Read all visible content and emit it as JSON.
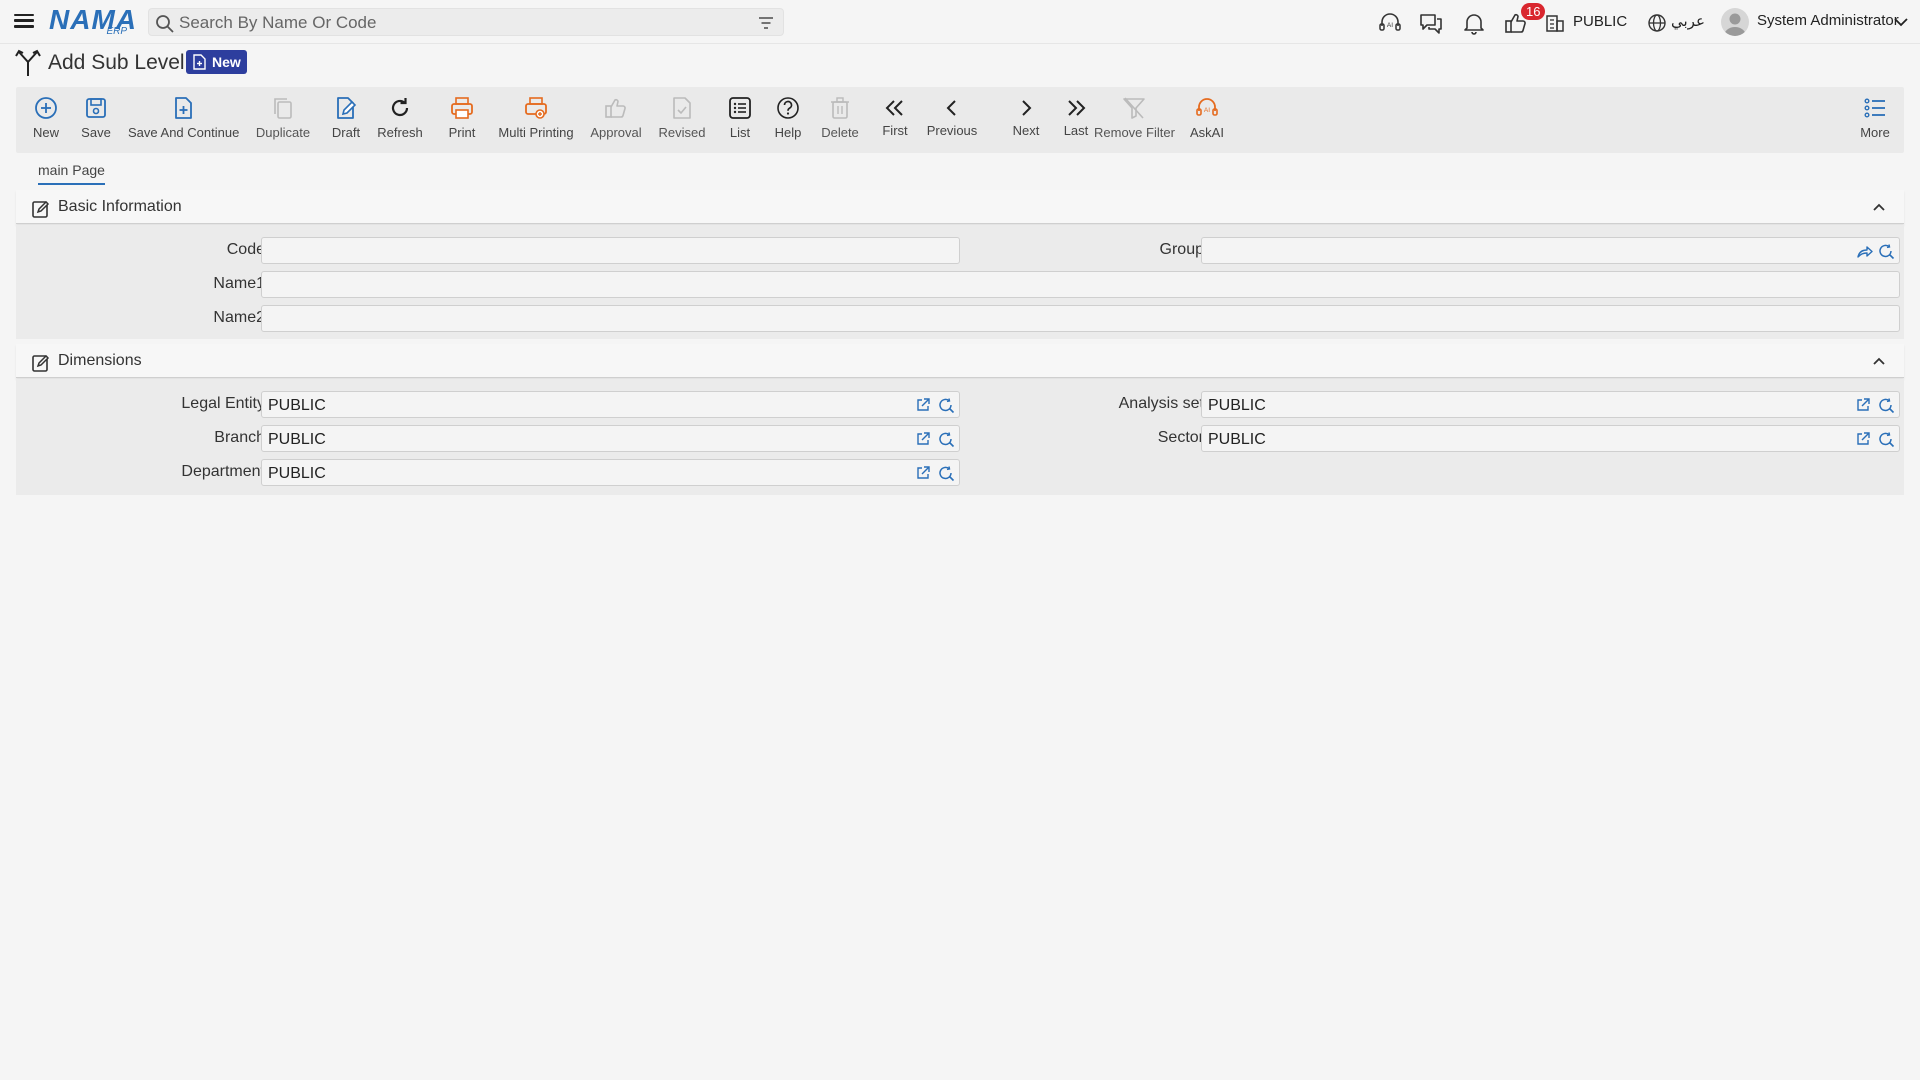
{
  "topbar": {
    "logo_main": "NAMA",
    "logo_sub": "ERP",
    "search_placeholder": "Search By Name Or Code",
    "notification_count": "16",
    "company": "PUBLIC",
    "language": "عربي",
    "user": "System Administrator"
  },
  "page": {
    "title": "Add Sub Level",
    "status_badge": "New"
  },
  "toolbar": {
    "new": "New",
    "save": "Save",
    "save_continue": "Save And Continue",
    "duplicate": "Duplicate",
    "draft": "Draft",
    "refresh": "Refresh",
    "print": "Print",
    "multi_printing": "Multi Printing",
    "approval": "Approval",
    "revised": "Revised",
    "list": "List",
    "help": "Help",
    "delete": "Delete",
    "first": "First",
    "previous": "Previous",
    "next": "Next",
    "last": "Last",
    "remove_filter": "Remove Filter",
    "askai": "AskAI",
    "more": "More"
  },
  "tabs": {
    "main": "main Page"
  },
  "basic_info": {
    "title": "Basic Information",
    "code_label": "Code",
    "code_value": "",
    "group_label": "Group",
    "group_value": "",
    "name1_label": "Name1",
    "name1_value": "",
    "name2_label": "Name2",
    "name2_value": ""
  },
  "dimensions": {
    "title": "Dimensions",
    "legal_entity_label": "Legal Entity",
    "legal_entity_value": "PUBLIC",
    "analysis_set_label": "Analysis set",
    "analysis_set_value": "PUBLIC",
    "branch_label": "Branch",
    "branch_value": "PUBLIC",
    "sector_label": "Sector",
    "sector_value": "PUBLIC",
    "department_label": "Department",
    "department_value": "PUBLIC"
  },
  "colors": {
    "accent_blue": "#2a6fb8",
    "orange": "#e56b1f",
    "badge_red": "#d9262e",
    "new_badge": "#2d3e9e"
  }
}
